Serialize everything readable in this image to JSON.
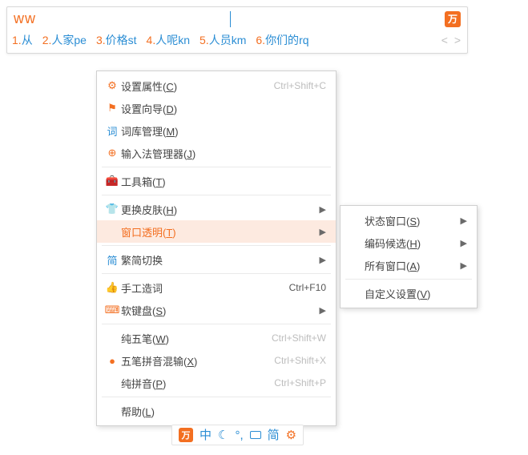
{
  "input": {
    "text": "ww",
    "logo_glyph": "万"
  },
  "candidates": [
    {
      "num": "1.",
      "word": "从",
      "suffix": ""
    },
    {
      "num": "2.",
      "word": "人家",
      "suffix": "pe"
    },
    {
      "num": "3.",
      "word": "价格",
      "suffix": "st"
    },
    {
      "num": "4.",
      "word": "人呢",
      "suffix": "kn"
    },
    {
      "num": "5.",
      "word": "人员",
      "suffix": "km"
    },
    {
      "num": "6.",
      "word": "你们的",
      "suffix": "rq"
    }
  ],
  "pager": "<  >",
  "menu": {
    "g1": [
      {
        "icon": "⚙",
        "label": "设置属性",
        "key": "C",
        "shortcut": "Ctrl+Shift+C"
      },
      {
        "icon": "⚑",
        "label": "设置向导",
        "key": "D",
        "shortcut": ""
      },
      {
        "icon": "词",
        "icon_blue": true,
        "label": "词库管理",
        "key": "M",
        "shortcut": ""
      },
      {
        "icon": "⊕",
        "label": "输入法管理器",
        "key": "J",
        "shortcut": ""
      }
    ],
    "g2": [
      {
        "icon": "🧰",
        "label": "工具箱",
        "key": "T",
        "shortcut": ""
      }
    ],
    "g3": [
      {
        "icon": "👕",
        "label": "更换皮肤",
        "key": "H",
        "shortcut": "",
        "submenu": true
      },
      {
        "icon": "",
        "label": "窗口透明",
        "key": "T",
        "shortcut": "",
        "submenu": true,
        "highlight": true
      }
    ],
    "g4": [
      {
        "icon": "简",
        "icon_blue": true,
        "label": "繁简切换",
        "key": "",
        "shortcut": "",
        "submenu": true
      }
    ],
    "g5": [
      {
        "icon": "👍",
        "label": "手工造词",
        "key": "",
        "shortcut": "Ctrl+F10",
        "shortcut_dark": true
      },
      {
        "icon": "⌨",
        "label": "软键盘",
        "key": "S",
        "shortcut": "",
        "submenu": true
      }
    ],
    "g6": [
      {
        "icon": "",
        "label": "纯五笔",
        "key": "W",
        "shortcut": "Ctrl+Shift+W"
      },
      {
        "icon": "●",
        "label": "五笔拼音混输",
        "key": "X",
        "shortcut": "Ctrl+Shift+X"
      },
      {
        "icon": "",
        "label": "纯拼音",
        "key": "P",
        "shortcut": "Ctrl+Shift+P"
      }
    ],
    "g7": [
      {
        "icon": "",
        "label": "帮助",
        "key": "L",
        "shortcut": ""
      }
    ]
  },
  "submenu": [
    {
      "label": "状态窗口",
      "key": "S",
      "submenu": true
    },
    {
      "label": "编码候选",
      "key": "H",
      "submenu": true
    },
    {
      "label": "所有窗口",
      "key": "A",
      "submenu": true
    },
    {
      "sep": true
    },
    {
      "label": "自定义设置",
      "key": "V",
      "submenu": false
    }
  ],
  "toolbar": {
    "logo": "万",
    "lang": "中",
    "moon": "☾",
    "punct": "°,",
    "simp": "简",
    "gear": "⚙"
  }
}
